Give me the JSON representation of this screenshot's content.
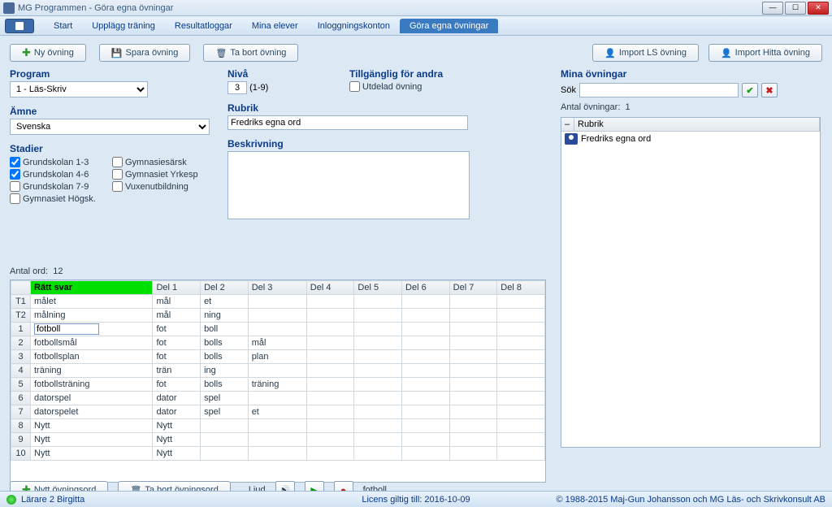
{
  "title": "MG Programmen - Göra egna övningar",
  "tabs": [
    "Start",
    "Upplägg träning",
    "Resultatloggar",
    "Mina elever",
    "Inloggningskonton",
    "Göra egna övningar"
  ],
  "active_tab": 5,
  "buttons": {
    "ny": "Ny övning",
    "spara": "Spara övning",
    "tabort": "Ta bort övning",
    "importls": "Import LS övning",
    "importhitta": "Import Hitta övning",
    "nyttord": "Nytt övningsord",
    "tabortord": "Ta bort övningsord"
  },
  "labels": {
    "program": "Program",
    "amne": "Ämne",
    "stadier": "Stadier",
    "niva": "Nivå",
    "niva_range": "(1-9)",
    "tillg": "Tillgänglig för andra",
    "utdelad": "Utdelad övning",
    "rubrik": "Rubrik",
    "beskriv": "Beskrivning",
    "mina": "Mina övningar",
    "sok": "Sök",
    "antal_ov": "Antal övningar:",
    "rubrik_col": "Rubrik",
    "antal_ord": "Antal ord:",
    "ljud": "Ljud"
  },
  "program_value": "1 - Läs-Skriv",
  "amne_value": "Svenska",
  "niva_value": "3",
  "rubrik_value": "Fredriks egna ord",
  "stadier": [
    {
      "label": "Grundskolan 1-3",
      "checked": true
    },
    {
      "label": "Gymnasiesärsk",
      "checked": false
    },
    {
      "label": "Grundskolan 4-6",
      "checked": true
    },
    {
      "label": "Gymnasiet Yrkesp",
      "checked": false
    },
    {
      "label": "Grundskolan 7-9",
      "checked": false
    },
    {
      "label": "Vuxenutbildning",
      "checked": false
    },
    {
      "label": "Gymnasiet Högsk.",
      "checked": false
    }
  ],
  "antal_ov_count": "1",
  "ov_list": [
    "Fredriks egna ord"
  ],
  "antal_ord_count": "12",
  "grid_headers": [
    "",
    "Rätt svar",
    "Del 1",
    "Del 2",
    "Del 3",
    "Del 4",
    "Del 5",
    "Del 6",
    "Del 7",
    "Del 8"
  ],
  "grid_rows": [
    {
      "n": "T1",
      "svar": "målet",
      "d": [
        "mål",
        "et",
        "",
        "",
        "",
        "",
        "",
        ""
      ]
    },
    {
      "n": "T2",
      "svar": "målning",
      "d": [
        "mål",
        "ning",
        "",
        "",
        "",
        "",
        "",
        ""
      ]
    },
    {
      "n": "1",
      "svar": "fotboll",
      "d": [
        "fot",
        "boll",
        "",
        "",
        "",
        "",
        "",
        ""
      ],
      "sel": true
    },
    {
      "n": "2",
      "svar": "fotbollsmål",
      "d": [
        "fot",
        "bolls",
        "mål",
        "",
        "",
        "",
        "",
        ""
      ]
    },
    {
      "n": "3",
      "svar": "fotbollsplan",
      "d": [
        "fot",
        "bolls",
        "plan",
        "",
        "",
        "",
        "",
        ""
      ]
    },
    {
      "n": "4",
      "svar": "träning",
      "d": [
        "trän",
        "ing",
        "",
        "",
        "",
        "",
        "",
        ""
      ]
    },
    {
      "n": "5",
      "svar": "fotbollsträning",
      "d": [
        "fot",
        "bolls",
        "träning",
        "",
        "",
        "",
        "",
        ""
      ]
    },
    {
      "n": "6",
      "svar": "datorspel",
      "d": [
        "dator",
        "spel",
        "",
        "",
        "",
        "",
        "",
        ""
      ]
    },
    {
      "n": "7",
      "svar": "datorspelet",
      "d": [
        "dator",
        "spel",
        "et",
        "",
        "",
        "",
        "",
        ""
      ]
    },
    {
      "n": "8",
      "svar": "Nytt",
      "d": [
        "Nytt",
        "",
        "",
        "",
        "",
        "",
        "",
        ""
      ]
    },
    {
      "n": "9",
      "svar": "Nytt",
      "d": [
        "Nytt",
        "",
        "",
        "",
        "",
        "",
        "",
        ""
      ]
    },
    {
      "n": "10",
      "svar": "Nytt",
      "d": [
        "Nytt",
        "",
        "",
        "",
        "",
        "",
        "",
        ""
      ]
    }
  ],
  "ljud_word": "fotboll",
  "status": {
    "user": "Lärare 2 Birgitta",
    "licens": "Licens giltig till: 2016-10-09",
    "copy": "© 1988-2015 Maj-Gun Johansson och MG Läs- och Skrivkonsult AB"
  }
}
